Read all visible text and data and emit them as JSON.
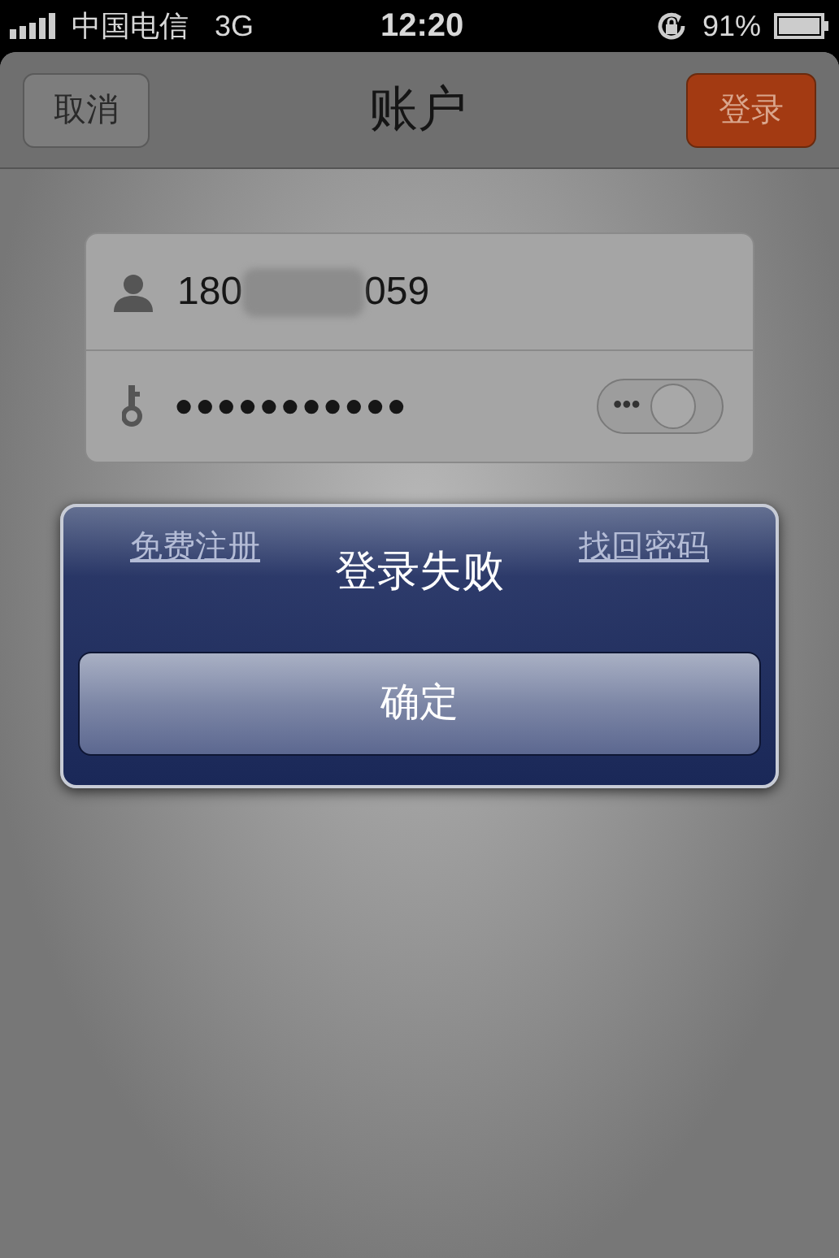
{
  "status_bar": {
    "carrier": "中国电信",
    "network": "3G",
    "time": "12:20",
    "battery": "91%"
  },
  "nav_bar": {
    "title": "账户",
    "left_button": "取消",
    "right_button": "登录"
  },
  "form": {
    "username": {
      "value_start": "180",
      "value_end": "059"
    },
    "password": {
      "value": "●●●●●●●●●●●",
      "show_toggle": {
        "label": "•••",
        "on": false
      }
    }
  },
  "links": [
    "免费注册",
    "找回密码"
  ],
  "alert": {
    "title": "登录失败",
    "buttons": [
      "确定"
    ]
  }
}
